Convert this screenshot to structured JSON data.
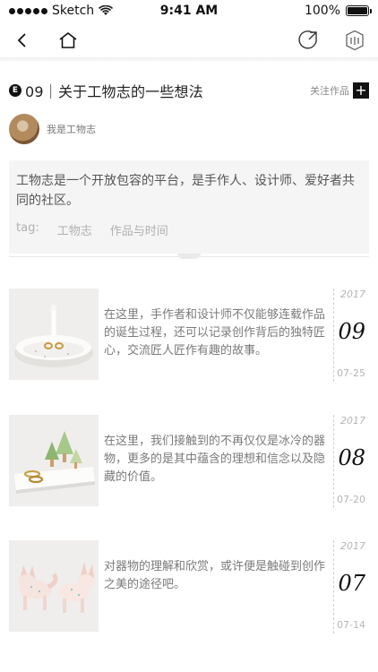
{
  "status_bar": {
    "carrier": "Sketch",
    "time": "9:41 AM",
    "battery": "100%",
    "battery_level": 1.0
  },
  "nav": {
    "icons": [
      "back-chevron-icon",
      "home-icon",
      "share-icon",
      "collection-icon"
    ]
  },
  "header": {
    "badge": "E",
    "title": "09｜关于工物志的一些想法",
    "follow_label": "关注作品",
    "follow_icon": "+"
  },
  "author": {
    "name": "我是工物志"
  },
  "description": {
    "text": "工物志是一个开放包容的平台，是手作人、设计师、爱好者共同的社区。",
    "tag_label": "tag:",
    "tags": [
      "工物志",
      "作品与时间"
    ]
  },
  "entries": [
    {
      "text": "在这里，手作者和设计师不仅能够连载作品的诞生过程，还可以记录创作背后的独特匠心，交流匠人匠作有趣的故事。",
      "year": "2017",
      "month": "09",
      "date": "07-25",
      "image": "ceramic-ring-dish"
    },
    {
      "text": "在这里，我们接触到的不再仅仅是冰冷的器物，更多的是其中蕴含的理想和信念以及隐藏的价值。",
      "year": "2017",
      "month": "08",
      "date": "07-20",
      "image": "tree-ring-tray"
    },
    {
      "text": "对器物的理解和欣赏，或许便是触碰到创作之美的途径吧。",
      "year": "2017",
      "month": "07",
      "date": "07-14",
      "image": "ceramic-foxes"
    }
  ]
}
